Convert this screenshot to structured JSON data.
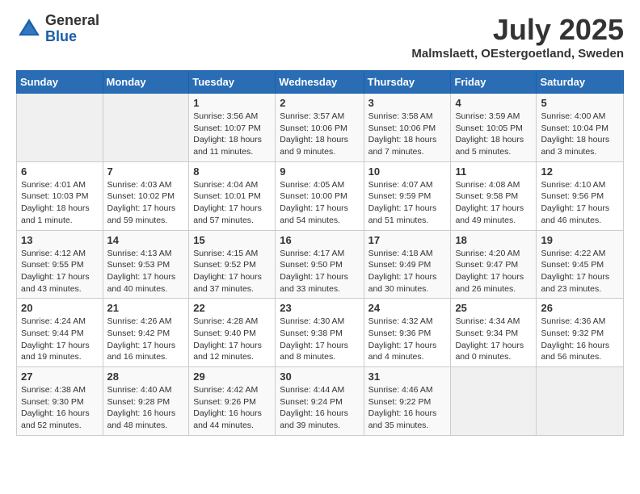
{
  "header": {
    "logo_general": "General",
    "logo_blue": "Blue",
    "month": "July 2025",
    "location": "Malmslaett, OEstergoetland, Sweden"
  },
  "days_of_week": [
    "Sunday",
    "Monday",
    "Tuesday",
    "Wednesday",
    "Thursday",
    "Friday",
    "Saturday"
  ],
  "weeks": [
    [
      {
        "day": "",
        "detail": ""
      },
      {
        "day": "",
        "detail": ""
      },
      {
        "day": "1",
        "detail": "Sunrise: 3:56 AM\nSunset: 10:07 PM\nDaylight: 18 hours and 11 minutes."
      },
      {
        "day": "2",
        "detail": "Sunrise: 3:57 AM\nSunset: 10:06 PM\nDaylight: 18 hours and 9 minutes."
      },
      {
        "day": "3",
        "detail": "Sunrise: 3:58 AM\nSunset: 10:06 PM\nDaylight: 18 hours and 7 minutes."
      },
      {
        "day": "4",
        "detail": "Sunrise: 3:59 AM\nSunset: 10:05 PM\nDaylight: 18 hours and 5 minutes."
      },
      {
        "day": "5",
        "detail": "Sunrise: 4:00 AM\nSunset: 10:04 PM\nDaylight: 18 hours and 3 minutes."
      }
    ],
    [
      {
        "day": "6",
        "detail": "Sunrise: 4:01 AM\nSunset: 10:03 PM\nDaylight: 18 hours and 1 minute."
      },
      {
        "day": "7",
        "detail": "Sunrise: 4:03 AM\nSunset: 10:02 PM\nDaylight: 17 hours and 59 minutes."
      },
      {
        "day": "8",
        "detail": "Sunrise: 4:04 AM\nSunset: 10:01 PM\nDaylight: 17 hours and 57 minutes."
      },
      {
        "day": "9",
        "detail": "Sunrise: 4:05 AM\nSunset: 10:00 PM\nDaylight: 17 hours and 54 minutes."
      },
      {
        "day": "10",
        "detail": "Sunrise: 4:07 AM\nSunset: 9:59 PM\nDaylight: 17 hours and 51 minutes."
      },
      {
        "day": "11",
        "detail": "Sunrise: 4:08 AM\nSunset: 9:58 PM\nDaylight: 17 hours and 49 minutes."
      },
      {
        "day": "12",
        "detail": "Sunrise: 4:10 AM\nSunset: 9:56 PM\nDaylight: 17 hours and 46 minutes."
      }
    ],
    [
      {
        "day": "13",
        "detail": "Sunrise: 4:12 AM\nSunset: 9:55 PM\nDaylight: 17 hours and 43 minutes."
      },
      {
        "day": "14",
        "detail": "Sunrise: 4:13 AM\nSunset: 9:53 PM\nDaylight: 17 hours and 40 minutes."
      },
      {
        "day": "15",
        "detail": "Sunrise: 4:15 AM\nSunset: 9:52 PM\nDaylight: 17 hours and 37 minutes."
      },
      {
        "day": "16",
        "detail": "Sunrise: 4:17 AM\nSunset: 9:50 PM\nDaylight: 17 hours and 33 minutes."
      },
      {
        "day": "17",
        "detail": "Sunrise: 4:18 AM\nSunset: 9:49 PM\nDaylight: 17 hours and 30 minutes."
      },
      {
        "day": "18",
        "detail": "Sunrise: 4:20 AM\nSunset: 9:47 PM\nDaylight: 17 hours and 26 minutes."
      },
      {
        "day": "19",
        "detail": "Sunrise: 4:22 AM\nSunset: 9:45 PM\nDaylight: 17 hours and 23 minutes."
      }
    ],
    [
      {
        "day": "20",
        "detail": "Sunrise: 4:24 AM\nSunset: 9:44 PM\nDaylight: 17 hours and 19 minutes."
      },
      {
        "day": "21",
        "detail": "Sunrise: 4:26 AM\nSunset: 9:42 PM\nDaylight: 17 hours and 16 minutes."
      },
      {
        "day": "22",
        "detail": "Sunrise: 4:28 AM\nSunset: 9:40 PM\nDaylight: 17 hours and 12 minutes."
      },
      {
        "day": "23",
        "detail": "Sunrise: 4:30 AM\nSunset: 9:38 PM\nDaylight: 17 hours and 8 minutes."
      },
      {
        "day": "24",
        "detail": "Sunrise: 4:32 AM\nSunset: 9:36 PM\nDaylight: 17 hours and 4 minutes."
      },
      {
        "day": "25",
        "detail": "Sunrise: 4:34 AM\nSunset: 9:34 PM\nDaylight: 17 hours and 0 minutes."
      },
      {
        "day": "26",
        "detail": "Sunrise: 4:36 AM\nSunset: 9:32 PM\nDaylight: 16 hours and 56 minutes."
      }
    ],
    [
      {
        "day": "27",
        "detail": "Sunrise: 4:38 AM\nSunset: 9:30 PM\nDaylight: 16 hours and 52 minutes."
      },
      {
        "day": "28",
        "detail": "Sunrise: 4:40 AM\nSunset: 9:28 PM\nDaylight: 16 hours and 48 minutes."
      },
      {
        "day": "29",
        "detail": "Sunrise: 4:42 AM\nSunset: 9:26 PM\nDaylight: 16 hours and 44 minutes."
      },
      {
        "day": "30",
        "detail": "Sunrise: 4:44 AM\nSunset: 9:24 PM\nDaylight: 16 hours and 39 minutes."
      },
      {
        "day": "31",
        "detail": "Sunrise: 4:46 AM\nSunset: 9:22 PM\nDaylight: 16 hours and 35 minutes."
      },
      {
        "day": "",
        "detail": ""
      },
      {
        "day": "",
        "detail": ""
      }
    ]
  ]
}
